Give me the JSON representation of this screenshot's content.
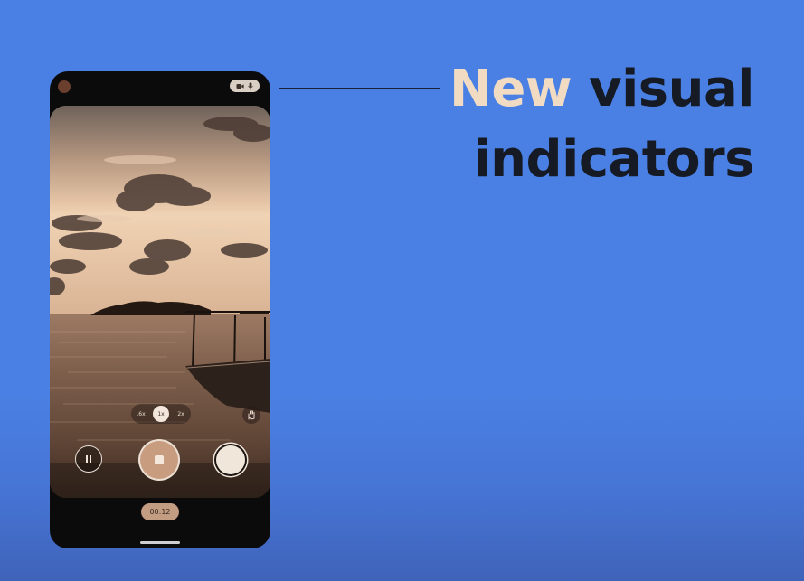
{
  "headline": {
    "accent": "New",
    "rest": "visual",
    "line2": "indicators"
  },
  "colors": {
    "background": "#4a80e3",
    "accent_text": "#f1dcc3",
    "dark_text": "#151a24",
    "phone_body": "#0b0b0c"
  },
  "phone": {
    "status_bar": {
      "front_camera_icon": "camera-lens-dot",
      "privacy_indicators": [
        "camera-icon",
        "microphone-icon"
      ]
    },
    "camera": {
      "zoom_options": [
        ".6x",
        "1x",
        "2x"
      ],
      "selected_zoom": "1x",
      "controls": [
        "pause-icon",
        "record-stop-icon",
        "shutter-icon",
        "hand-gesture-icon"
      ],
      "timer": "00:12"
    }
  }
}
